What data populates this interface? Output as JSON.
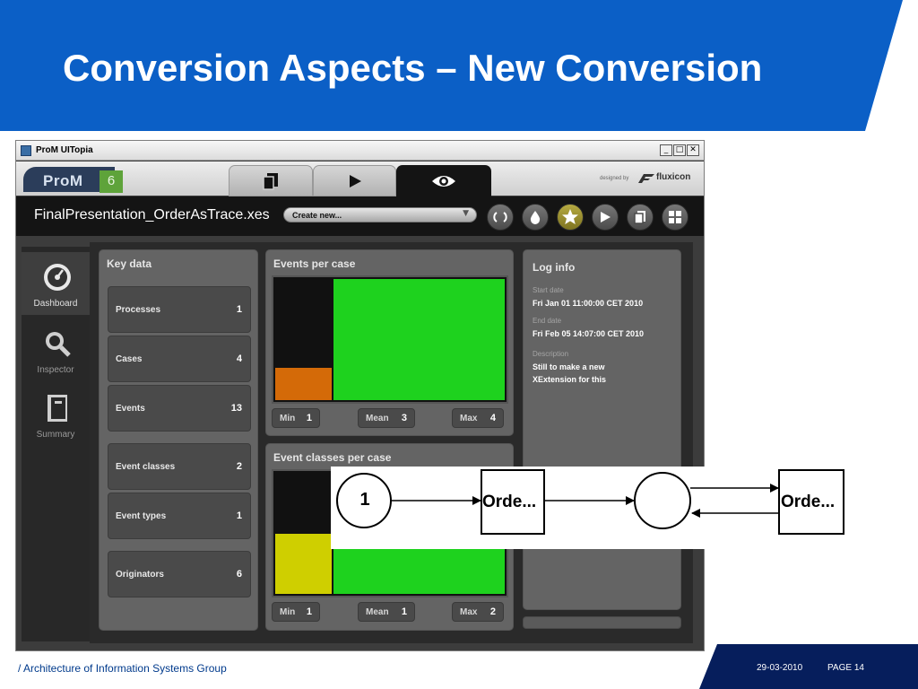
{
  "slide": {
    "title": "Conversion Aspects – New Conversion",
    "footer_text": "/ Architecture of Information Systems Group",
    "footer_date": "29-03-2010",
    "footer_page": "PAGE 14"
  },
  "colors": {
    "banner_blue": "#0b5fc6",
    "footer_navy": "#061e5c",
    "accent_green": "#1ed21e",
    "accent_orange": "#d46a08",
    "accent_yellow": "#cfcf00"
  },
  "window": {
    "title": "ProM UITopia",
    "minimize": "_",
    "maximize": "□",
    "close": "✕",
    "logo_text": "ProM",
    "logo_version": "6",
    "designed_by": "designed by",
    "brand": "fluxicon",
    "tabs": [
      {
        "name": "workspace",
        "icon": "pages-icon"
      },
      {
        "name": "action",
        "icon": "play-icon"
      },
      {
        "name": "view",
        "icon": "eye-icon"
      }
    ]
  },
  "view_header": {
    "filename": "FinalPresentation_OrderAsTrace.xes",
    "create_new": "Create new...",
    "buttons": [
      "refresh-icon",
      "drop-icon",
      "star-icon",
      "play-icon",
      "pages-icon",
      "grid-icon"
    ]
  },
  "nav": {
    "items": [
      {
        "label": "Dashboard",
        "icon": "dashboard-gauge-icon",
        "active": true
      },
      {
        "label": "Inspector",
        "icon": "magnifier-icon",
        "active": false
      },
      {
        "label": "Summary",
        "icon": "book-icon",
        "active": false
      }
    ]
  },
  "key_data": {
    "title": "Key data",
    "rows": [
      {
        "label": "Processes",
        "value": "1"
      },
      {
        "label": "Cases",
        "value": "4"
      },
      {
        "label": "Events",
        "value": "13"
      },
      {
        "label": "Event classes",
        "value": "2"
      },
      {
        "label": "Event types",
        "value": "1"
      },
      {
        "label": "Originators",
        "value": "6"
      }
    ]
  },
  "events_per_case": {
    "title": "Events per case",
    "min_label": "Min",
    "min": "1",
    "mean_label": "Mean",
    "mean": "3",
    "max_label": "Max",
    "max": "4"
  },
  "event_classes_per_case": {
    "title": "Event classes per case",
    "min_label": "Min",
    "min": "1",
    "mean_label": "Mean",
    "mean": "1",
    "max_label": "Max",
    "max": "2"
  },
  "log_info": {
    "title": "Log info",
    "start_caption": "Start date",
    "start_value": "Fri Jan 01 11:00:00 CET 2010",
    "end_caption": "End date",
    "end_value": "Fri Feb 05 14:07:00 CET 2010",
    "desc_caption": "Description",
    "desc_value": "Still to make a new XExtension for this"
  },
  "petri_net": {
    "place1_tokens": "1",
    "transition1_label": "Orde...",
    "transition2_label": "Orde..."
  }
}
